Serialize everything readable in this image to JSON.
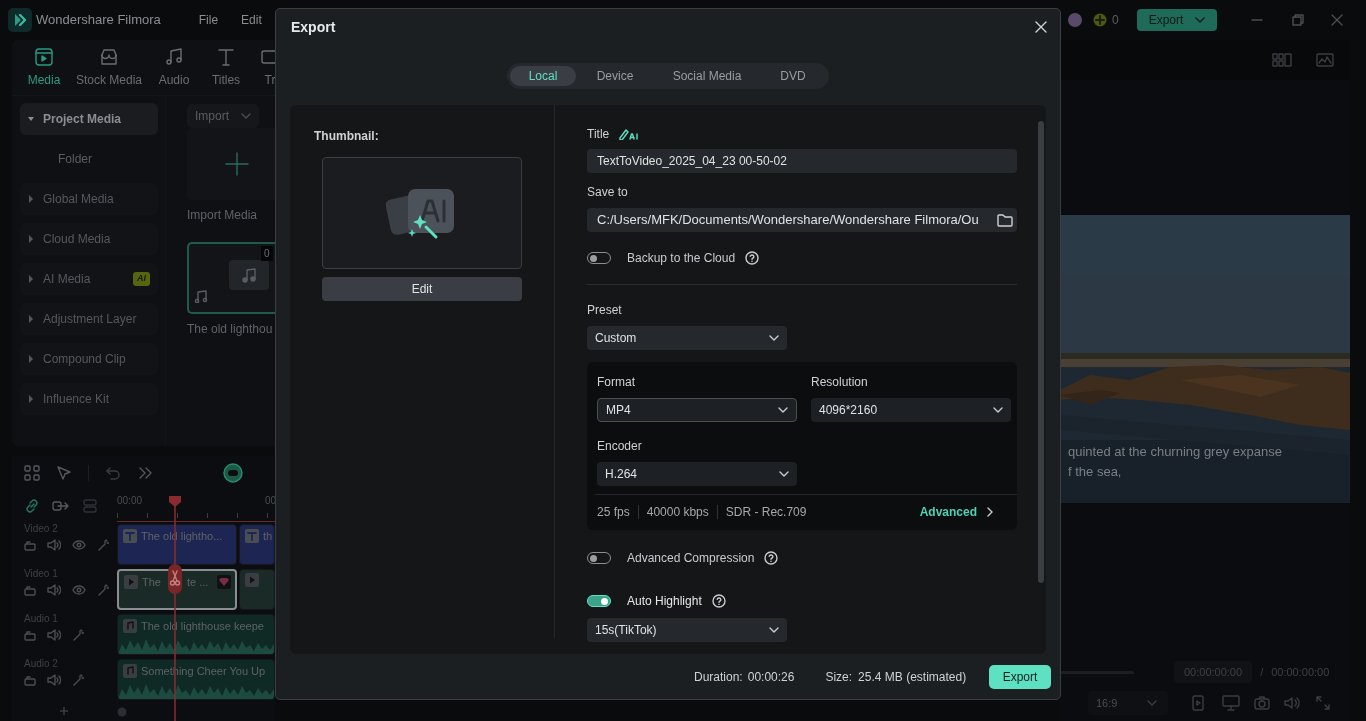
{
  "app": {
    "title": "Wondershare Filmora",
    "menu": [
      "File",
      "Edit"
    ],
    "credits": "0",
    "export_button": "Export"
  },
  "media_tabs": [
    {
      "label": "Media",
      "selected": true
    },
    {
      "label": "Stock Media",
      "selected": false
    },
    {
      "label": "Audio",
      "selected": false
    },
    {
      "label": "Titles",
      "selected": false
    },
    {
      "label": "Tr",
      "selected": false
    }
  ],
  "media_sidebar": [
    {
      "label": "Project Media",
      "kind": "group",
      "expanded": true,
      "selected": true
    },
    {
      "label": "Folder",
      "kind": "folder"
    },
    {
      "label": "Global Media",
      "kind": "group",
      "expanded": false,
      "selected": false
    },
    {
      "label": "Cloud Media",
      "kind": "group",
      "expanded": false,
      "selected": false
    },
    {
      "label": "AI Media",
      "kind": "group",
      "expanded": false,
      "selected": false,
      "badge": "AI"
    },
    {
      "label": "Adjustment Layer",
      "kind": "group",
      "expanded": false,
      "selected": false
    },
    {
      "label": "Compound Clip",
      "kind": "group",
      "expanded": false,
      "selected": false
    },
    {
      "label": "Influence Kit",
      "kind": "group",
      "expanded": false,
      "selected": false
    }
  ],
  "media_toolbar": {
    "import": "Import"
  },
  "media_items": [
    {
      "label": "Import Media",
      "kind": "import"
    },
    {
      "label": "The old lighthou",
      "kind": "audio",
      "duration": "0"
    }
  ],
  "timeline": {
    "ruler": [
      "00:00",
      "00"
    ],
    "tracks": [
      {
        "name": "Video 2",
        "kind": "video",
        "clips": [
          {
            "label": "The old lightho...",
            "kind": "title",
            "selected": false
          },
          {
            "label": "th",
            "kind": "title",
            "selected": false
          }
        ]
      },
      {
        "name": "Video 1",
        "kind": "video",
        "clips": [
          {
            "label": "The",
            "label_tail": "te ...",
            "kind": "video",
            "selected": true
          },
          {
            "kind": "video",
            "selected": false
          }
        ]
      },
      {
        "name": "Audio 1",
        "kind": "audio",
        "clips": [
          {
            "label": "The old lighthouse keepe",
            "kind": "audio",
            "selected": false
          }
        ]
      },
      {
        "name": "Audio 2",
        "kind": "audio",
        "clips": [
          {
            "label": "Something Cheer You Up",
            "kind": "audio",
            "selected": false
          }
        ]
      }
    ]
  },
  "preview": {
    "subtitle": [
      "quinted at the churning grey expanse",
      "f the sea,"
    ],
    "current_time": "00:00:00:00",
    "separator": "/",
    "total_time": "00:00:00:00",
    "aspect": "16:9"
  },
  "export_dialog": {
    "title": "Export",
    "tabs": [
      {
        "label": "Local",
        "selected": true
      },
      {
        "label": "Device",
        "selected": false
      },
      {
        "label": "Social Media",
        "selected": false
      },
      {
        "label": "DVD",
        "selected": false
      }
    ],
    "thumbnail_label": "Thumbnail:",
    "edit_button": "Edit",
    "title_label": "Title",
    "title_value": "TextToVideo_2025_04_23 00-50-02",
    "save_to_label": "Save to",
    "save_to_value": "C:/Users/MFK/Documents/Wondershare/Wondershare Filmora/Ou",
    "backup": {
      "label": "Backup to the Cloud",
      "on": false
    },
    "preset_label": "Preset",
    "preset_value": "Custom",
    "format_label": "Format",
    "format_value": "MP4",
    "resolution_label": "Resolution",
    "resolution_value": "4096*2160",
    "encoder_label": "Encoder",
    "encoder_value": "H.264",
    "specs": [
      "25 fps",
      "40000 kbps",
      "SDR - Rec.709"
    ],
    "advanced": "Advanced",
    "advanced_compression": {
      "label": "Advanced Compression",
      "on": false
    },
    "auto_highlight": {
      "label": "Auto Highlight",
      "on": true
    },
    "highlight_value": "15s(TikTok)",
    "duration_label": "Duration:",
    "duration_value": "00:00:26",
    "size_label": "Size:",
    "size_value": "25.4 MB (estimated)",
    "export_button": "Export"
  }
}
